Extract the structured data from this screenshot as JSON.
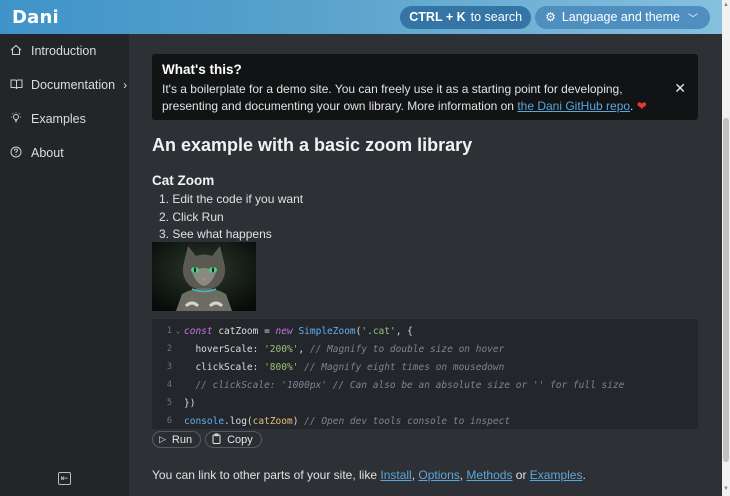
{
  "header": {
    "brand": "Dani",
    "search_shortcut": "CTRL + K",
    "search_label": "to search",
    "language_label": "Language and theme"
  },
  "sidebar": {
    "items": [
      {
        "label": "Introduction",
        "icon": "home-icon"
      },
      {
        "label": "Documentation",
        "icon": "book-icon"
      },
      {
        "label": "Examples",
        "icon": "bulb-icon"
      },
      {
        "label": "About",
        "icon": "question-icon"
      }
    ]
  },
  "notice": {
    "title": "What's this?",
    "text_before": "It's a boilerplate for a demo site. You can freely use it as a starting point for developing, presenting and documenting your own library. More information on ",
    "link": "the Dani GitHub repo",
    "text_after": "."
  },
  "main": {
    "heading": "An example with a basic zoom library",
    "subheading": "Cat Zoom",
    "steps": [
      "1. Edit the code if you want",
      "2. Click Run",
      "3. See what happens"
    ]
  },
  "code": {
    "lines": [
      {
        "n": "1",
        "tokens": [
          [
            "kw",
            "const"
          ],
          [
            "plain",
            " catZoom = "
          ],
          [
            "kw",
            "new"
          ],
          [
            "plain",
            " "
          ],
          [
            "fn",
            "SimpleZoom"
          ],
          [
            "plain",
            "("
          ],
          [
            "str",
            "'.cat'"
          ],
          [
            "plain",
            ", {"
          ]
        ]
      },
      {
        "n": "2",
        "tokens": [
          [
            "plain",
            "  hoverScale: "
          ],
          [
            "str",
            "'200%'"
          ],
          [
            "plain",
            ", "
          ],
          [
            "cm",
            "// Magnify to double size on hover"
          ]
        ]
      },
      {
        "n": "3",
        "tokens": [
          [
            "plain",
            "  clickScale: "
          ],
          [
            "str",
            "'800%'"
          ],
          [
            "plain",
            " "
          ],
          [
            "cm",
            "// Magnify eight times on mousedown"
          ]
        ]
      },
      {
        "n": "4",
        "tokens": [
          [
            "cm",
            "  // clickScale: '1000px' // Can also be an absolute size or '' for full size"
          ]
        ]
      },
      {
        "n": "5",
        "tokens": [
          [
            "plain",
            "})"
          ]
        ]
      },
      {
        "n": "6",
        "tokens": [
          [
            "fn",
            "console"
          ],
          [
            "plain",
            ".log("
          ],
          [
            "var",
            "catZoom"
          ],
          [
            "plain",
            ") "
          ],
          [
            "cm",
            "// Open dev tools console to inspect"
          ]
        ]
      }
    ]
  },
  "actions": {
    "run": "Run",
    "copy": "Copy"
  },
  "footer": {
    "text_before": "You can link to other parts of your site, like ",
    "links": [
      "Install",
      "Options",
      "Methods",
      "Examples"
    ],
    "sep1": ", ",
    "sep2": ", ",
    "sep3": " or ",
    "text_after": "."
  },
  "colors": {
    "accent": "#3f93c9",
    "link": "#5aa7d9",
    "heart": "#e53935"
  }
}
